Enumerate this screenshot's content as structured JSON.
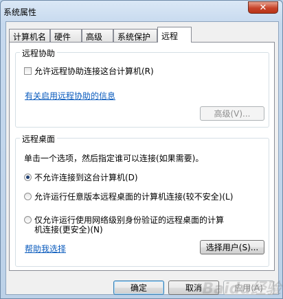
{
  "window": {
    "title": "系统属性",
    "close_glyph": "✕"
  },
  "tabs": [
    {
      "label": "计算机名",
      "active": false
    },
    {
      "label": "硬件",
      "active": false
    },
    {
      "label": "高级",
      "active": false
    },
    {
      "label": "系统保护",
      "active": false
    },
    {
      "label": "远程",
      "active": true
    }
  ],
  "remote_assistance": {
    "title": "远程协助",
    "allow_label": "允许远程协助连接这台计算机(R)",
    "allow_checked": false,
    "info_link": "有关启用远程协助的信息",
    "advanced_button": "高级(V)..."
  },
  "remote_desktop": {
    "title": "远程桌面",
    "instruction": "单击一个选项，然后指定谁可以连接(如果需要)。",
    "options": [
      {
        "line1": "不允许连接到这台计算机(D)",
        "line2": "",
        "selected": true
      },
      {
        "line1": "允许运行任意版本远程桌面的计算机连接(较不安全)(L)",
        "line2": "",
        "selected": false
      },
      {
        "line1": "仅允许运行使用网络级别身份验证的远程桌面的计算",
        "line2": "机连接(更安全)(N)",
        "selected": false
      }
    ],
    "help_link": "帮助我选择",
    "select_users_button": "选择用户(S)..."
  },
  "footer": {
    "ok": "确定",
    "cancel": "取消",
    "apply": "应用(A)"
  },
  "watermark": "Baidu经验",
  "colors": {
    "link": "#0a5bbd",
    "close_button": "#c7442a"
  }
}
